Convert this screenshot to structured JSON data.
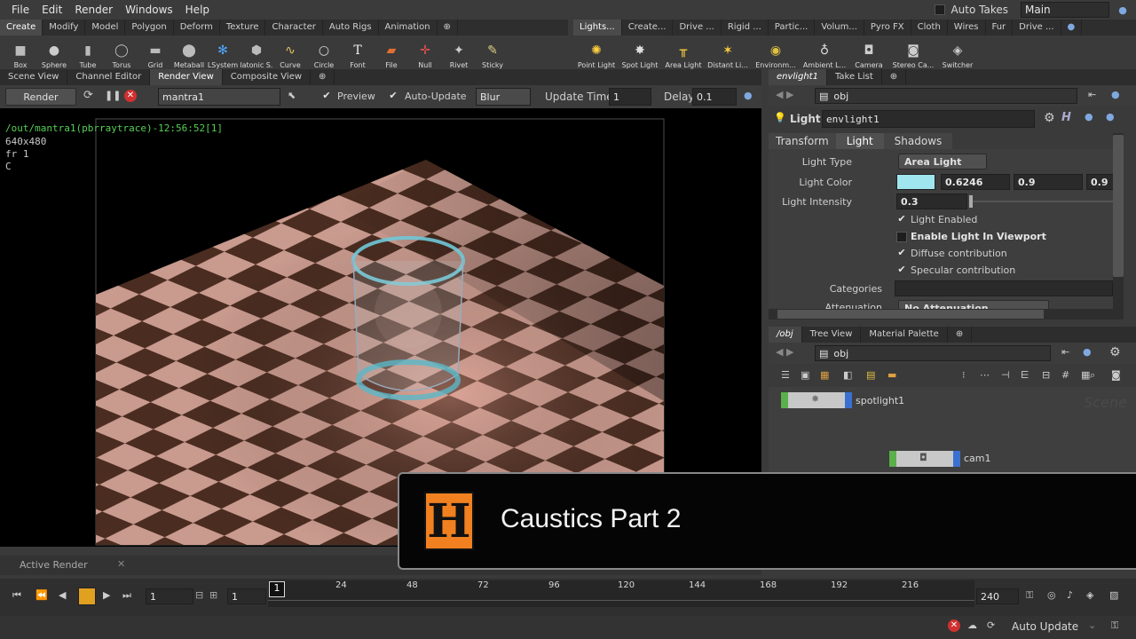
{
  "menu": [
    "File",
    "Edit",
    "Render",
    "Windows",
    "Help"
  ],
  "auto_takes_label": "Auto Takes",
  "desktop_name": "Main",
  "shelf_left": {
    "tabs": [
      "Create",
      "Modify",
      "Model",
      "Polygon",
      "Deform",
      "Texture",
      "Character",
      "Auto Rigs",
      "Animation"
    ],
    "tools": [
      "Box",
      "Sphere",
      "Tube",
      "Torus",
      "Grid",
      "Metaball",
      "LSystem",
      "Platonic S...",
      "Curve",
      "Circle",
      "Font",
      "File",
      "Null",
      "Rivet",
      "Sticky"
    ]
  },
  "shelf_right": {
    "tabs": [
      "Lights...",
      "Create...",
      "Drive ...",
      "Rigid ...",
      "Partic...",
      "Volum...",
      "Pyro FX",
      "Cloth",
      "Wires",
      "Fur",
      "Drive ..."
    ],
    "tools": [
      "Point Light",
      "Spot Light",
      "Area Light",
      "Distant Li...",
      "Environm...",
      "Ambient L...",
      "Camera",
      "Stereo Ca...",
      "Switcher"
    ]
  },
  "left_pane": {
    "tabs": [
      "Scene View",
      "Channel Editor",
      "Render View",
      "Composite View"
    ],
    "render_btn": "Render",
    "renderer": "mantra1",
    "preview_label": "Preview",
    "auto_update_label": "Auto-Update",
    "blur_label": "Blur",
    "update_time_label": "Update Time",
    "update_time_value": "1",
    "delay_label": "Delay",
    "delay_value": "0.1"
  },
  "render_overlay": {
    "path": "/out/mantra1(pbrraytrace)-12:56:52[1]",
    "resolution": "640x480",
    "frame": "fr 1",
    "channel": "C"
  },
  "active_render_label": "Active Render",
  "param_pane": {
    "tabs": [
      "envlight1",
      "Take List"
    ],
    "path": "obj",
    "node_type": "Light",
    "node_name": "envlight1",
    "sub_tabs": [
      "Transform",
      "Light",
      "Shadows"
    ],
    "light_type_label": "Light Type",
    "light_type_value": "Area Light",
    "light_color_label": "Light Color",
    "light_color_r": "0.6246",
    "light_color_g": "0.9",
    "light_color_b": "0.9",
    "light_color_swatch": "#9fe6ee",
    "light_intensity_label": "Light Intensity",
    "light_intensity_value": "0.3",
    "light_enabled": "Light Enabled",
    "enable_in_viewport": "Enable Light In Viewport",
    "diffuse": "Diffuse contribution",
    "specular": "Specular contribution",
    "categories_label": "Categories",
    "attenuation_label": "Attenuation",
    "attenuation_value": "No Attenuation"
  },
  "network_pane": {
    "tabs": [
      "/obj",
      "Tree View",
      "Material Palette"
    ],
    "path": "obj",
    "nodes": [
      "spotlight1",
      "cam1"
    ],
    "watermark": "Scene"
  },
  "timeline": {
    "start": "1",
    "current": "1",
    "ticks": [
      "1",
      "24",
      "48",
      "72",
      "96",
      "120",
      "144",
      "168",
      "192",
      "216"
    ],
    "end": "240"
  },
  "status": {
    "auto_update": "Auto Update"
  },
  "banner": {
    "title": "Caustics Part 2",
    "logo_letter": "H"
  }
}
